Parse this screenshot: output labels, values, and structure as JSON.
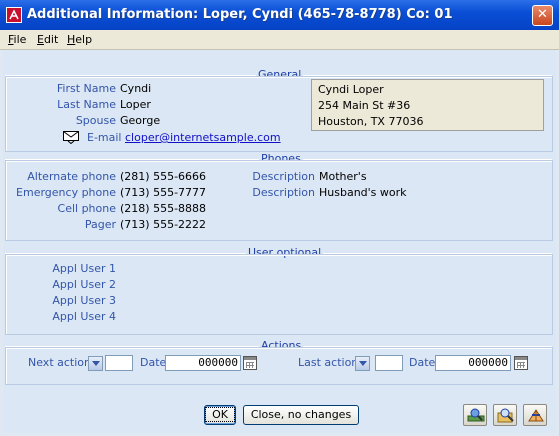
{
  "window": {
    "title": "Additional Information: Loper, Cyndi (465-78-8778) Co: 01",
    "close_glyph": "✕"
  },
  "menu": [
    {
      "label": "File",
      "accel": "F",
      "rest": "ile"
    },
    {
      "label": "Edit",
      "accel": "E",
      "rest": "dit"
    },
    {
      "label": "Help",
      "accel": "H",
      "rest": "elp"
    }
  ],
  "general": {
    "title": "General",
    "first_name_label": "First Name",
    "first_name": "Cyndi",
    "last_name_label": "Last Name",
    "last_name": "Loper",
    "spouse_label": "Spouse",
    "spouse": "George",
    "email_label": "E-mail",
    "email": "cloper@internetsample.com",
    "address": [
      "Cyndi Loper",
      "254 Main St #36",
      "Houston, TX  77036"
    ]
  },
  "phones": {
    "title": "Phones",
    "alternate_label": "Alternate phone",
    "alternate": "(281) 555-6666",
    "emergency_label": "Emergency phone",
    "emergency": "(713) 555-7777",
    "cell_label": "Cell phone",
    "cell": "(218) 555-8888",
    "pager_label": "Pager",
    "pager": "(713) 555-2222",
    "desc1_label": "Description",
    "desc1": "Mother's",
    "desc2_label": "Description",
    "desc2": "Husband's work"
  },
  "user_optional": {
    "title": "User optional",
    "labels": [
      "Appl User 1",
      "Appl User 2",
      "Appl User 3",
      "Appl User 4"
    ]
  },
  "actions": {
    "title": "Actions",
    "next_label": "Next action",
    "next_value": "",
    "date_label": "Date",
    "next_date": "000000",
    "last_label": "Last action",
    "last_value": "",
    "last_date_label": "Date",
    "last_date": "000000"
  },
  "buttons": {
    "ok": "OK",
    "close": "Close, no changes"
  },
  "icons": [
    "app-icon",
    "mail-icon",
    "calendar-icon",
    "tool-icon-1",
    "tool-icon-2",
    "tool-icon-3"
  ]
}
